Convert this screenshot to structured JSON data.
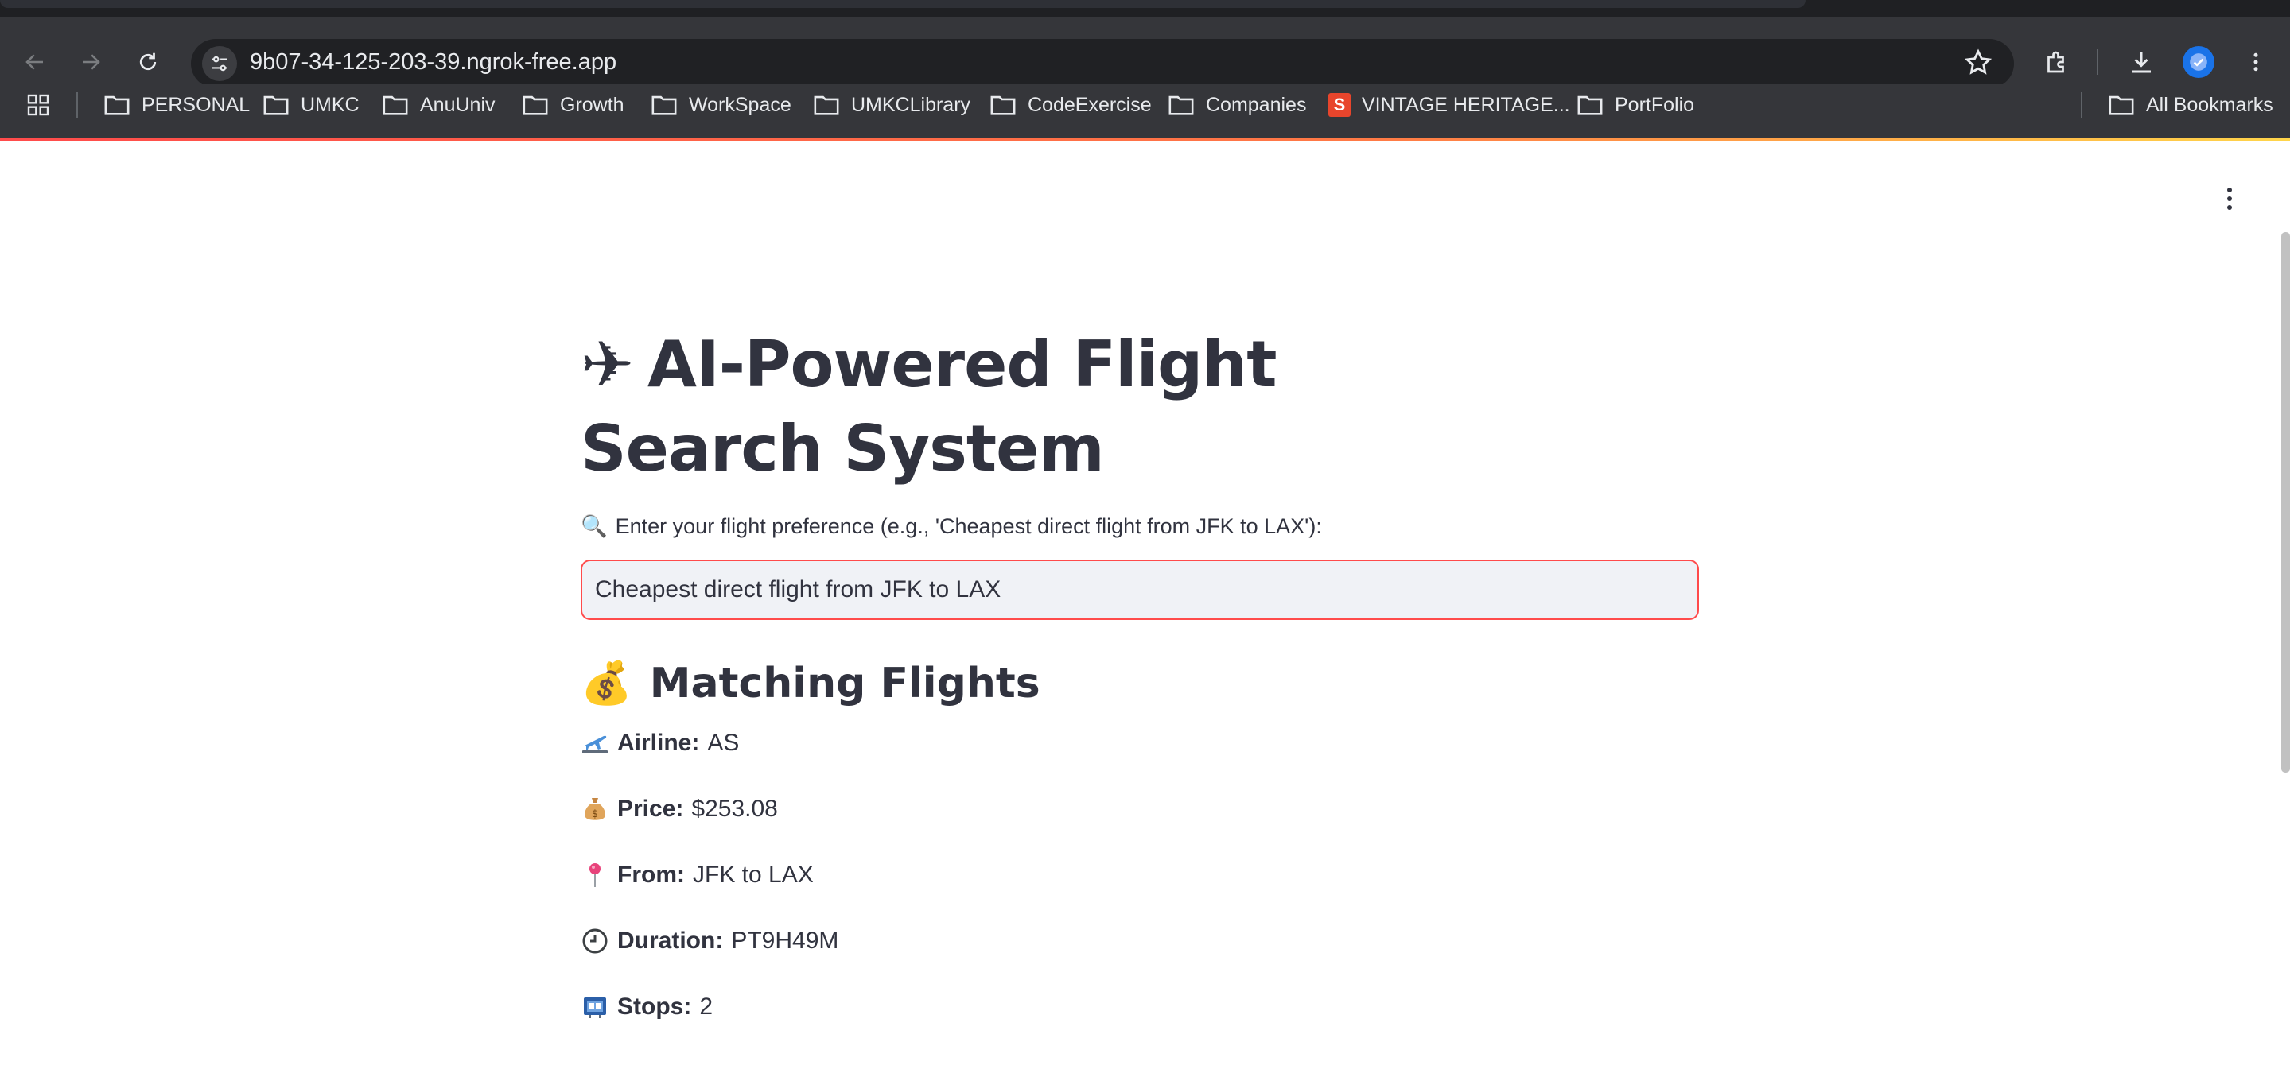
{
  "browser": {
    "url": "9b07-34-125-203-39.ngrok-free.app",
    "bookmarks": [
      {
        "label": "PERSONAL",
        "icon": "folder-icon"
      },
      {
        "label": "UMKC",
        "icon": "folder-icon"
      },
      {
        "label": "AnuUniv",
        "icon": "folder-icon"
      },
      {
        "label": "Growth",
        "icon": "folder-icon"
      },
      {
        "label": "WorkSpace",
        "icon": "folder-icon"
      },
      {
        "label": "UMKCLibrary",
        "icon": "folder-icon"
      },
      {
        "label": "CodeExercise",
        "icon": "folder-icon"
      },
      {
        "label": "Companies",
        "icon": "folder-icon"
      },
      {
        "label": "VINTAGE HERITAGE...",
        "icon": "s-site-icon"
      },
      {
        "label": "PortFolio",
        "icon": "folder-icon"
      }
    ],
    "all_bookmarks_label": "All Bookmarks"
  },
  "app": {
    "title_icon": "✈",
    "title": "AI-Powered Flight Search System",
    "prompt_icon": "🔍",
    "prompt_label": "Enter your flight preference (e.g., 'Cheapest direct flight from JFK to LAX'):",
    "search_value": "Cheapest direct flight from JFK to LAX",
    "results_icon": "💰",
    "results_heading": "Matching Flights",
    "flight": {
      "airline_label": "Airline:",
      "airline_value": "AS",
      "price_label": "Price:",
      "price_value": "$253.08",
      "from_label": "From:",
      "from_value": "JFK to LAX",
      "duration_label": "Duration:",
      "duration_value": "PT9H49M",
      "stops_label": "Stops:",
      "stops_value": "2"
    }
  },
  "colors": {
    "accent": "#ff4b4b",
    "text": "#31333f",
    "input_bg": "#f0f2f6",
    "chrome_bg": "#35363a",
    "omnibox_bg": "#202124"
  }
}
